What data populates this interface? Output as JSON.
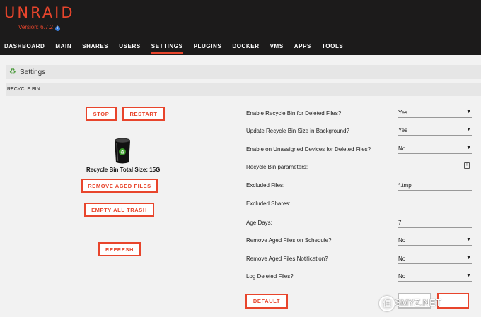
{
  "app": {
    "logo_text": "UNRAID",
    "version": "Version: 6.7.2"
  },
  "nav": {
    "items": [
      {
        "label": "DASHBOARD"
      },
      {
        "label": "MAIN"
      },
      {
        "label": "SHARES"
      },
      {
        "label": "USERS"
      },
      {
        "label": "SETTINGS",
        "active": true
      },
      {
        "label": "PLUGINS"
      },
      {
        "label": "DOCKER"
      },
      {
        "label": "VMS"
      },
      {
        "label": "APPS"
      },
      {
        "label": "TOOLS"
      }
    ]
  },
  "page": {
    "title": "Settings",
    "title_icon": "recycle-icon",
    "section": "RECYCLE BIN"
  },
  "left_panel": {
    "stop_label": "STOP",
    "restart_label": "RESTART",
    "trash_icon": "trash-can-icon",
    "total_size": "Recycle Bin Total Size: 15G",
    "remove_aged_label": "REMOVE AGED FILES",
    "empty_all_label": "EMPTY ALL TRASH",
    "refresh_label": "REFRESH"
  },
  "settings": [
    {
      "label": "Enable Recycle Bin for Deleted Files?",
      "value": "Yes",
      "type": "select"
    },
    {
      "label": "Update Recycle Bin Size in Background?",
      "value": "Yes",
      "type": "select"
    },
    {
      "label": "Enable on Unassigned Devices for Deleted Files?",
      "value": "No",
      "type": "select"
    },
    {
      "label": "Recycle Bin parameters:",
      "value": "",
      "type": "text-icon"
    },
    {
      "label": "Excluded Files:",
      "value": "*.tmp",
      "type": "text"
    },
    {
      "label": "Excluded Shares:",
      "value": "",
      "type": "text"
    },
    {
      "label": "Age Days:",
      "value": "7",
      "type": "text"
    },
    {
      "label": "Remove Aged Files on Schedule?",
      "value": "No",
      "type": "select"
    },
    {
      "label": "Remove Aged Files Notification?",
      "value": "No",
      "type": "select"
    },
    {
      "label": "Log Deleted Files?",
      "value": "No",
      "type": "select"
    }
  ],
  "footer": {
    "default_label": "DEFAULT"
  },
  "watermark": {
    "circle_text": "值",
    "text": "SMYZ.NET"
  },
  "colors": {
    "accent": "#e8452c",
    "header_bg": "#1c1b1b",
    "page_bg": "#f2f2f2"
  }
}
